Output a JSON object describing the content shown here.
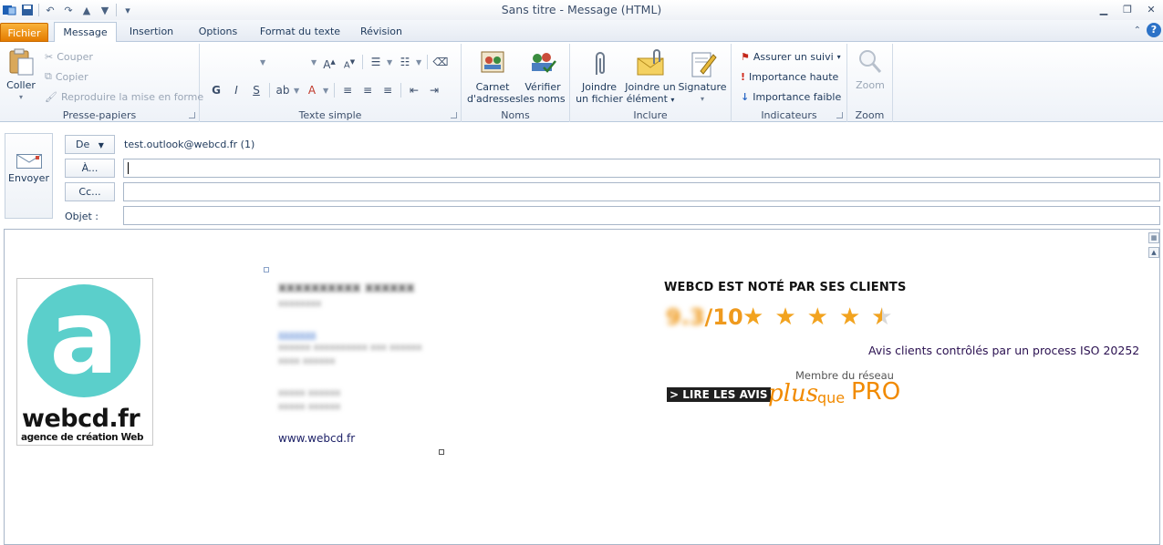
{
  "window": {
    "title": "Sans titre  -  Message (HTML)"
  },
  "qat": {
    "icons": [
      "outlook-icon",
      "save-icon",
      "undo-icon",
      "redo-icon",
      "up-icon",
      "down-icon",
      "customize-icon"
    ]
  },
  "tabs": {
    "file": "Fichier",
    "message": "Message",
    "insert": "Insertion",
    "options": "Options",
    "format": "Format du texte",
    "review": "Révision"
  },
  "ribbon": {
    "clipboard": {
      "label": "Presse-papiers",
      "paste": "Coller",
      "cut": "Couper",
      "copy": "Copier",
      "format_painter": "Reproduire la mise en forme"
    },
    "basic_text": {
      "label": "Texte simple",
      "bold": "G",
      "italic": "I",
      "underline": "S"
    },
    "names": {
      "label": "Noms",
      "address_book_1": "Carnet",
      "address_book_2": "d'adresses",
      "check_names_1": "Vérifier",
      "check_names_2": "les noms"
    },
    "include": {
      "label": "Inclure",
      "attach_file_1": "Joindre",
      "attach_file_2": "un fichier",
      "attach_item_1": "Joindre un",
      "attach_item_2": "élément",
      "signature": "Signature"
    },
    "tags": {
      "label": "Indicateurs",
      "follow_up": "Assurer un suivi",
      "high_importance": "Importance haute",
      "low_importance": "Importance faible"
    },
    "zoom": {
      "label": "Zoom",
      "zoom": "Zoom"
    }
  },
  "compose": {
    "send": "Envoyer",
    "from_button": "De",
    "from_address": "test.outlook@webcd.fr (1)",
    "to_button": "À...",
    "cc_button": "Cc...",
    "subject_label": "Objet :",
    "to_value": "",
    "cc_value": "",
    "subject_value": ""
  },
  "signature": {
    "logo_text": "webcd.fr",
    "logo_sub": "agence de création Web",
    "name_blurred": "xxxxxxxxxx xxxxxx",
    "role_blurred": "xxxxxxxx",
    "link_blurred": "xxxxxxx",
    "line1_blurred": "xxxxxx xxxxxxxxxx xxx xxxxxx",
    "line2_blurred": "xxxx xxxxxx",
    "line3_blurred": "xxxxx xxxxxx",
    "line4_blurred": "xxxxx xxxxxx",
    "website": "www.webcd.fr"
  },
  "rating": {
    "title": "WEBCD EST NOTÉ PAR SES CLIENTS",
    "score_blurred": "9.3",
    "score_suffix": "/10",
    "stars_value": 4.5,
    "stars_max": 5,
    "iso_text": "Avis clients contrôlés par un process ISO 20252",
    "read_reviews": "> LIRE LES AVIS",
    "member": "Membre du réseau",
    "brand_plus": "plus",
    "brand_que": "que",
    "brand_pro": "PRO"
  },
  "colors": {
    "file_tab": "#f39a1e",
    "accent": "#1e395b",
    "star": "#f2a31f",
    "teal_logo": "#5bcfcb",
    "brand_orange": "#f18a00"
  }
}
